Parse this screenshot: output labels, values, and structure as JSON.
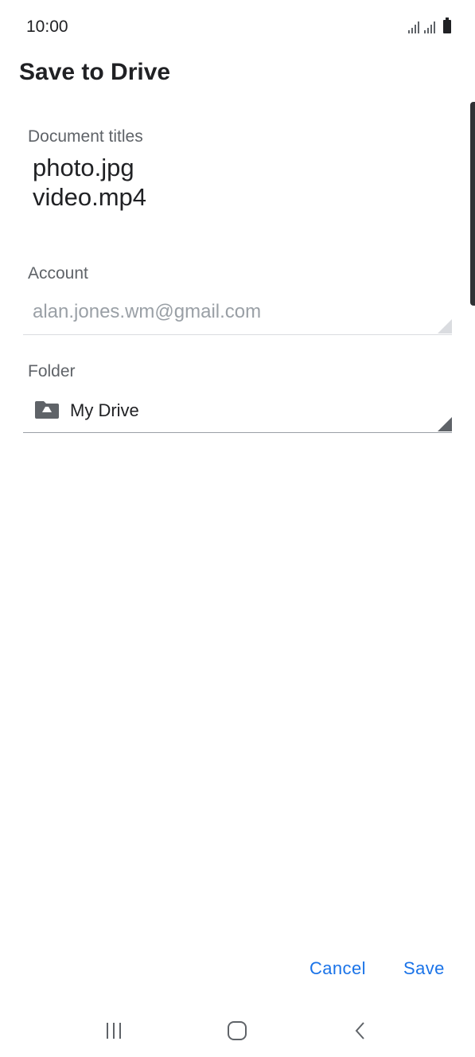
{
  "status_bar": {
    "time": "10:00",
    "icons": [
      "signal-icon",
      "signal-icon",
      "battery-icon"
    ]
  },
  "header": {
    "title": "Save to Drive"
  },
  "document_titles": {
    "label": "Document titles",
    "items": [
      "photo.jpg",
      "video.mp4"
    ]
  },
  "account": {
    "label": "Account",
    "value": "alan.jones.wm@gmail.com"
  },
  "folder": {
    "label": "Folder",
    "value": "My Drive",
    "icon": "drive-folder-icon"
  },
  "actions": {
    "cancel_label": "Cancel",
    "save_label": "Save"
  },
  "nav_bar": {
    "icons": [
      "recent-apps-icon",
      "home-icon",
      "back-icon"
    ]
  },
  "colors": {
    "accent": "#1a73e8",
    "text_primary": "#202124",
    "text_secondary": "#5f6368",
    "text_disabled": "#9aa0a6"
  }
}
